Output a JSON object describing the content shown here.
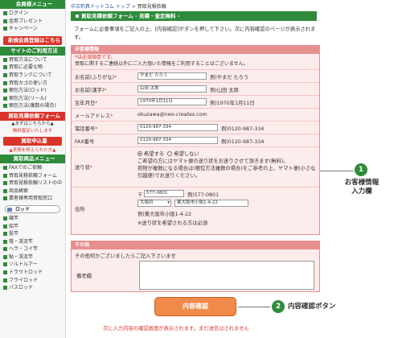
{
  "sidebar": {
    "member_menu": "会員様メニュー",
    "member_items": [
      "ログイン",
      "金券プレゼント",
      "キャンペーン"
    ],
    "register_banner": "新規会員登録はこちら",
    "guide_head": "サイトのご利用方法",
    "guide_items": [
      "買取方法について",
      "買取に必要な物",
      "買取ランクについて",
      "買取カゴの使い方",
      "梱包方法(ロッド)",
      "梱包方法(リール)",
      "梱包方法(複数の場合)"
    ],
    "estimate_head": "買取見積依頼フォーム",
    "estimate_note1": "▲まずはこちらから▲",
    "estimate_note2": "無料査定いたします",
    "apply_head": "買取申込書",
    "apply_note": "▲見積を終えられた方▲",
    "product_head": "買取商品メニュー",
    "product_items": [
      "FAXでのご依頼",
      "買取見積依頼フォーム",
      "買取見積依頼リストの中",
      "商品検索",
      "業者様専用買取窓口"
    ],
    "rod_pill": "ロッド",
    "category_items": [
      "磯竿",
      "船竿",
      "投竿",
      "筏・渓流竿",
      "ヘラ・コイ竿",
      "鮎・渓流竿",
      "ソルトルアー",
      "トラウトロッド",
      "フライロッド",
      "バスロッド"
    ]
  },
  "breadcrumb": {
    "home": "中古釣具ドットコム トップ",
    "sep": " > ",
    "current": "買取見積依頼"
  },
  "form": {
    "title": "買取見積依頼フォーム - 見積・査定無料 -",
    "intro": "フォームに必要事項をご記入の上、[内容確認]ボタンを押して下さい。次に内容確認のページが表示されます。",
    "customer_head": "お客様情報",
    "required_note": "*は必須項目です。",
    "privacy_note": "買取に関するご連絡以外にご入力頂いた情報をご利用することはございません。",
    "furigana": {
      "label": "お名前(ふりがな)",
      "value": "やまだ たろう",
      "example": "例)やまだ たろう"
    },
    "kanji_name": {
      "label": "お名前(漢字)",
      "value": "山田 太郎",
      "example": "例)山田 太郎"
    },
    "birth": {
      "label": "生年月日",
      "value": "1970年1月11日",
      "example": "例)1970年1月11日"
    },
    "email": {
      "label": "メールアドレス",
      "value": "okuzawa@neo-creates.com"
    },
    "phone": {
      "label": "電話番号",
      "value": "0120-987-334",
      "example": "例)0120-987-334"
    },
    "fax": {
      "label": "FAX番号",
      "value": "0120-987-334",
      "example": "例)0120-987-334"
    },
    "kit": {
      "label": "送り状",
      "option_yes": "希望する",
      "option_no": "希望しない",
      "note1": "ご希望の方にはヤマト便の送り状をお送りさせて頂きます(無料)。",
      "note2": "荷物が複数になる場合は(梱包方法複数の場合)をご参考の上、ヤマト便(小さな引越便)でお送りください。"
    },
    "address": {
      "label": "住所",
      "zip_mark": "〒",
      "zip": "577-0801",
      "zip_example": "例)577-0801",
      "prefecture": "大阪府",
      "street": "東大阪市小阪1-4-22",
      "example": "例)東大阪市小阪1-4-22",
      "note": "※送り状を希望される方は必須"
    },
    "other_head": "その他",
    "other_prompt": "その他何かございましたらご記入下さいませ",
    "memo_label": "備考欄",
    "confirm_button": "内容確認",
    "confirm_note": "次に入力内容の確認画面が表示されます。まだ送信はされません"
  },
  "callouts": [
    {
      "number": "1",
      "label_line1": "お客様情報",
      "label_line2": "入力欄"
    },
    {
      "number": "2",
      "label_line1": "内容確認ボタン"
    }
  ],
  "colors": {
    "accent_green": "#2e8b3a",
    "accent_red": "#d9342b",
    "section_pink": "#fdecec",
    "button_orange": "#f08a4b"
  }
}
